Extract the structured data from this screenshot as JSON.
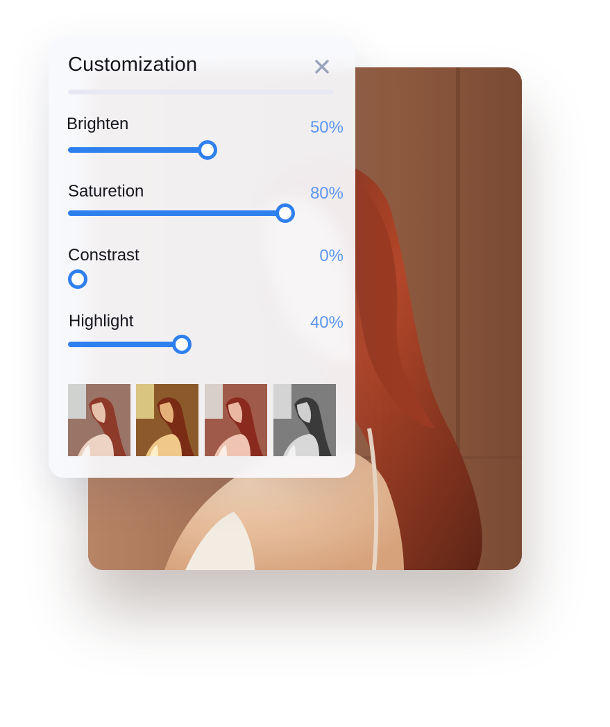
{
  "panel": {
    "title": "Customization",
    "close_icon": "close-icon"
  },
  "sliders": [
    {
      "label": "Brighten",
      "value_text": "50%",
      "fill": 0.5
    },
    {
      "label": "Saturetion",
      "value_text": "80%",
      "fill": 0.8
    },
    {
      "label": "Constrast",
      "value_text": "0%",
      "fill": 0.0
    },
    {
      "label": "Highlight",
      "value_text": "40%",
      "fill": 0.4
    }
  ],
  "presets": [
    {
      "name": "original"
    },
    {
      "name": "warm"
    },
    {
      "name": "vivid"
    },
    {
      "name": "mono"
    }
  ],
  "colors": {
    "accent": "#2f80ef",
    "value_text": "#5c97f0",
    "divider": "#e7e8f3"
  }
}
